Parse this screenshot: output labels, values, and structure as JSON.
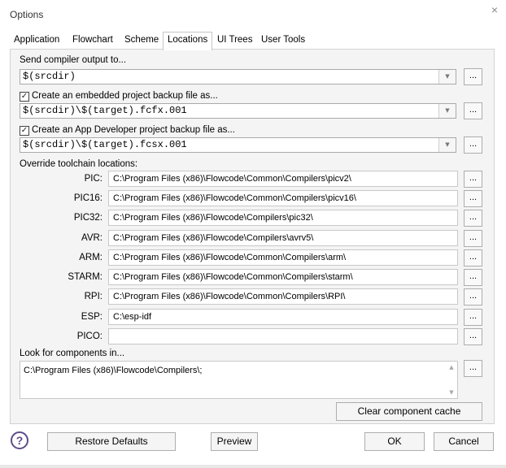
{
  "window": {
    "title": "Options",
    "close_glyph": "×"
  },
  "tabs": [
    {
      "label": "Application"
    },
    {
      "label": "Flowchart"
    },
    {
      "label": "Scheme"
    },
    {
      "label": "Locations",
      "active": true
    },
    {
      "label": "UI Trees"
    },
    {
      "label": "User Tools"
    }
  ],
  "compiler_output": {
    "label": "Send compiler output to...",
    "value": "$(srcdir)"
  },
  "embedded_backup": {
    "label": "Create an embedded project backup file as...",
    "checked": true,
    "value": "$(srcdir)\\$(target).fcfx.001"
  },
  "appdev_backup": {
    "label": "Create an App Developer project backup file as...",
    "checked": true,
    "value": "$(srcdir)\\$(target).fcsx.001"
  },
  "toolchain": {
    "heading": "Override toolchain locations:",
    "items": [
      {
        "label": "PIC:",
        "path": "C:\\Program Files (x86)\\Flowcode\\Common\\Compilers\\picv2\\"
      },
      {
        "label": "PIC16:",
        "path": "C:\\Program Files (x86)\\Flowcode\\Common\\Compilers\\picv16\\"
      },
      {
        "label": "PIC32:",
        "path": "C:\\Program Files (x86)\\Flowcode\\Compilers\\pic32\\"
      },
      {
        "label": "AVR:",
        "path": "C:\\Program Files (x86)\\Flowcode\\Compilers\\avrv5\\"
      },
      {
        "label": "ARM:",
        "path": "C:\\Program Files (x86)\\Flowcode\\Common\\Compilers\\arm\\"
      },
      {
        "label": "STARM:",
        "path": "C:\\Program Files (x86)\\Flowcode\\Common\\Compilers\\starm\\"
      },
      {
        "label": "RPI:",
        "path": "C:\\Program Files (x86)\\Flowcode\\Common\\Compilers\\RPI\\"
      },
      {
        "label": "ESP:",
        "path": "C:\\esp-idf"
      },
      {
        "label": "PICO:",
        "path": ""
      }
    ]
  },
  "components": {
    "label": "Look for components in...",
    "value": "C:\\Program Files (x86)\\Flowcode\\Compilers\\;"
  },
  "buttons": {
    "browse": "...",
    "clear_cache": "Clear component cache",
    "restore_defaults": "Restore Defaults",
    "preview": "Preview",
    "ok": "OK",
    "cancel": "Cancel",
    "help": "?"
  },
  "icons": {
    "help": "help-icon",
    "dropdown": "chevron-down-icon",
    "close": "close-icon",
    "check": "check-icon"
  }
}
